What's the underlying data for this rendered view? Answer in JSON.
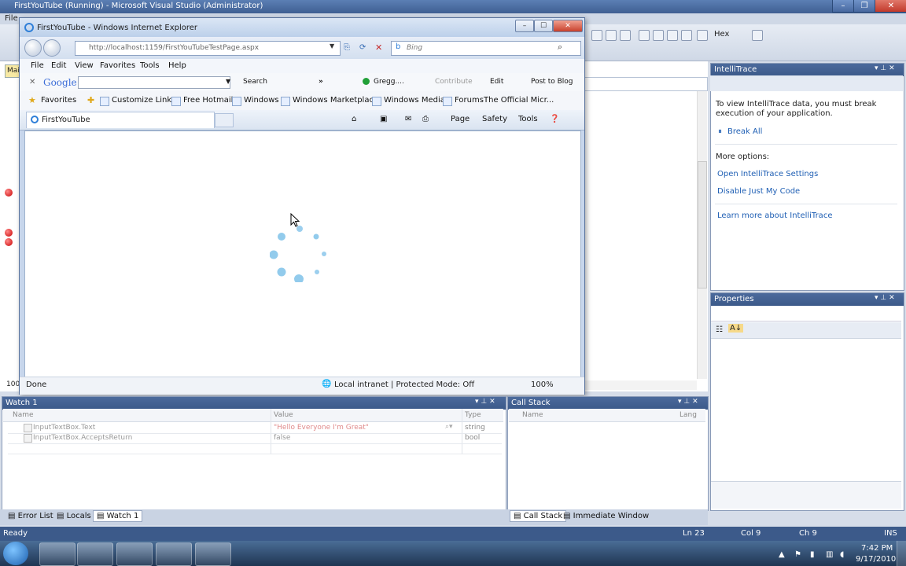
{
  "vs": {
    "title": "FirstYouTube (Running) - Microsoft Visual Studio (Administrator)",
    "menu_first": "File",
    "hex_label": "Hex",
    "editor_tab": "Mai",
    "editor_zoom": "100"
  },
  "ie": {
    "title": "FirstYouTube - Windows Internet Explorer",
    "address": "http://localhost:1159/FirstYouTubeTestPage.aspx",
    "search_placeholder": "Bing",
    "menu": [
      "File",
      "Edit",
      "View",
      "Favorites",
      "Tools",
      "Help"
    ],
    "google": {
      "logo": "Google",
      "search": "Search",
      "user": "Gregg....",
      "contribute": "Contribute",
      "edit": "Edit",
      "post": "Post to Blog"
    },
    "favorites": {
      "label": "Favorites",
      "items": [
        "Customize Links",
        "Free Hotmail",
        "Windows",
        "Windows Marketplace",
        "Windows Media",
        "Forums",
        "The Official Micr..."
      ]
    },
    "tab_title": "FirstYouTube",
    "commands": [
      "Page",
      "Safety",
      "Tools"
    ],
    "status": {
      "done": "Done",
      "zone": "Local intranet | Protected Mode: Off",
      "zoom": "100%"
    }
  },
  "intellitrace": {
    "title": "IntelliTrace",
    "message": "To view IntelliTrace data, you must break execution of your application.",
    "break_all": "Break All",
    "more_options": "More options:",
    "open_settings": "Open IntelliTrace Settings",
    "disable_jmc": "Disable Just My Code",
    "learn_more": "Learn more about IntelliTrace"
  },
  "properties": {
    "title": "Properties"
  },
  "watch": {
    "title": "Watch 1",
    "columns": [
      "Name",
      "Value",
      "Type"
    ],
    "rows": [
      {
        "name": "InputTextBox.Text",
        "value": "\"Hello Everyone I'm Great\"",
        "type": "string"
      },
      {
        "name": "InputTextBox.AcceptsReturn",
        "value": "false",
        "type": "bool"
      }
    ]
  },
  "callstack": {
    "title": "Call Stack",
    "columns": [
      "Name",
      "Lang"
    ]
  },
  "bottom_tabs": {
    "left": [
      "Error List",
      "Locals",
      "Watch 1"
    ],
    "right": [
      "Call Stack",
      "Immediate Window"
    ]
  },
  "status_bar": {
    "ready": "Ready",
    "ln": "Ln 23",
    "col": "Col 9",
    "ch": "Ch 9",
    "ins": "INS"
  },
  "taskbar": {
    "time": "7:42 PM",
    "date": "9/17/2010"
  },
  "colors": {
    "accent": "#3c5a89",
    "link": "#1f5fb4",
    "spinner": "#4aa8e0",
    "breakpoint": "#c80000"
  }
}
